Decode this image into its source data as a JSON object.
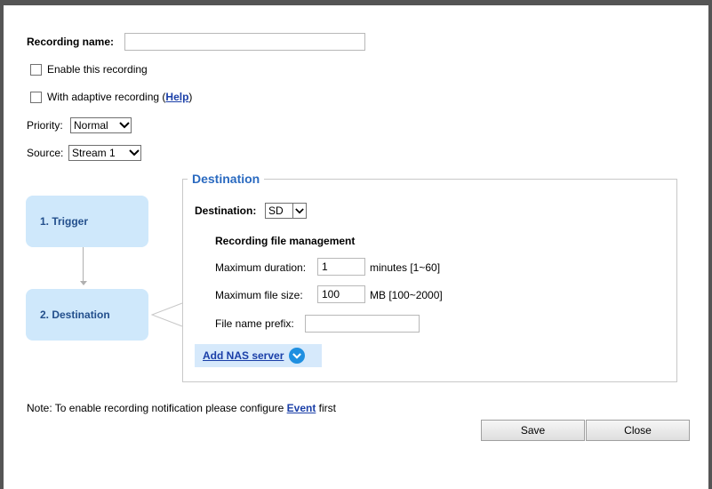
{
  "recording_name": {
    "label": "Recording name:",
    "value": ""
  },
  "enable_recording": {
    "label": "Enable this recording",
    "checked": false
  },
  "adaptive": {
    "label_prefix": "With adaptive recording (",
    "help_link": "Help",
    "label_suffix": ")",
    "checked": false
  },
  "priority": {
    "label": "Priority:",
    "value": "Normal"
  },
  "source": {
    "label": "Source:",
    "value": "Stream 1"
  },
  "steps": [
    {
      "label": "1.  Trigger"
    },
    {
      "label": "2.  Destination"
    }
  ],
  "destination_panel": {
    "legend": "Destination",
    "destination_label": "Destination:",
    "destination_value": "SD",
    "file_mgmt_title": "Recording file management",
    "max_duration": {
      "label": "Maximum duration:",
      "value": "1",
      "unit": "minutes [1~60]"
    },
    "max_file_size": {
      "label": "Maximum file size:",
      "value": "100",
      "unit": "MB [100~2000]"
    },
    "file_prefix": {
      "label": "File name prefix:",
      "value": ""
    },
    "add_nas": "Add NAS server"
  },
  "note": {
    "prefix": "Note: To enable recording notification please configure ",
    "link": "Event",
    "suffix": " first"
  },
  "buttons": {
    "save": "Save",
    "close": "Close"
  }
}
